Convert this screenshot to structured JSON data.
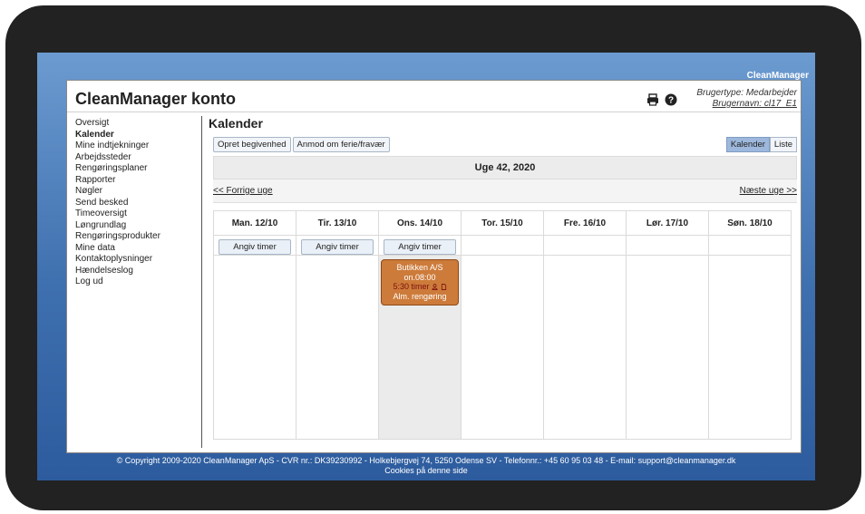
{
  "app": {
    "brand": "CleanManager",
    "panel_title": "CleanManager konto"
  },
  "user": {
    "type": "Brugertype: Medarbejder",
    "name": "Brugernavn: cl17_E1"
  },
  "icons": [
    "print-icon",
    "help-icon"
  ],
  "sidebar": {
    "items": [
      {
        "label": "Oversigt",
        "active": false
      },
      {
        "label": "Kalender",
        "active": true
      },
      {
        "label": "Mine indtjekninger",
        "active": false
      },
      {
        "label": "Arbejdssteder",
        "active": false
      },
      {
        "label": "Rengøringsplaner",
        "active": false
      },
      {
        "label": "Rapporter",
        "active": false
      },
      {
        "label": "Nøgler",
        "active": false
      },
      {
        "label": "Send besked",
        "active": false
      },
      {
        "label": "Timeoversigt",
        "active": false
      },
      {
        "label": "Løngrundlag",
        "active": false
      },
      {
        "label": "Rengøringsprodukter",
        "active": false
      },
      {
        "label": "Mine data",
        "active": false
      },
      {
        "label": "Kontaktoplysninger",
        "active": false
      },
      {
        "label": "Hændelseslog",
        "active": false
      },
      {
        "label": "Log ud",
        "active": false
      }
    ]
  },
  "main": {
    "title": "Kalender",
    "buttons": {
      "create_event": "Opret begivenhed",
      "request_leave": "Anmod om ferie/fravær"
    },
    "view_toggle": {
      "calendar": "Kalender",
      "list": "Liste",
      "selected": "Kalender"
    },
    "week_label": "Uge 42, 2020",
    "prev_week": "<< Forrige uge",
    "next_week": "Næste uge >>",
    "days": [
      {
        "label": "Man. 12/10",
        "angiv": "Angiv timer",
        "today": false
      },
      {
        "label": "Tir. 13/10",
        "angiv": "Angiv timer",
        "today": false
      },
      {
        "label": "Ons. 14/10",
        "angiv": "Angiv timer",
        "today": true
      },
      {
        "label": "Tor. 15/10",
        "angiv": "",
        "today": false
      },
      {
        "label": "Fre. 16/10",
        "angiv": "",
        "today": false
      },
      {
        "label": "Lør. 17/10",
        "angiv": "",
        "today": false
      },
      {
        "label": "Søn. 18/10",
        "angiv": "",
        "today": false
      }
    ],
    "event": {
      "place": "Butikken A/S",
      "time": "on.08:00",
      "hours": "5:30 timer",
      "task": "Alm. rengøring",
      "color": "#cd7b3a"
    }
  },
  "footer": {
    "line1": "© Copyright 2009-2020 CleanManager ApS - CVR nr.: DK39230992 - Holkebjergvej 74, 5250 Odense SV - Telefonnr.: +45 60 95 03 48 - E-mail: support@cleanmanager.dk",
    "line2": "Cookies på denne side"
  }
}
